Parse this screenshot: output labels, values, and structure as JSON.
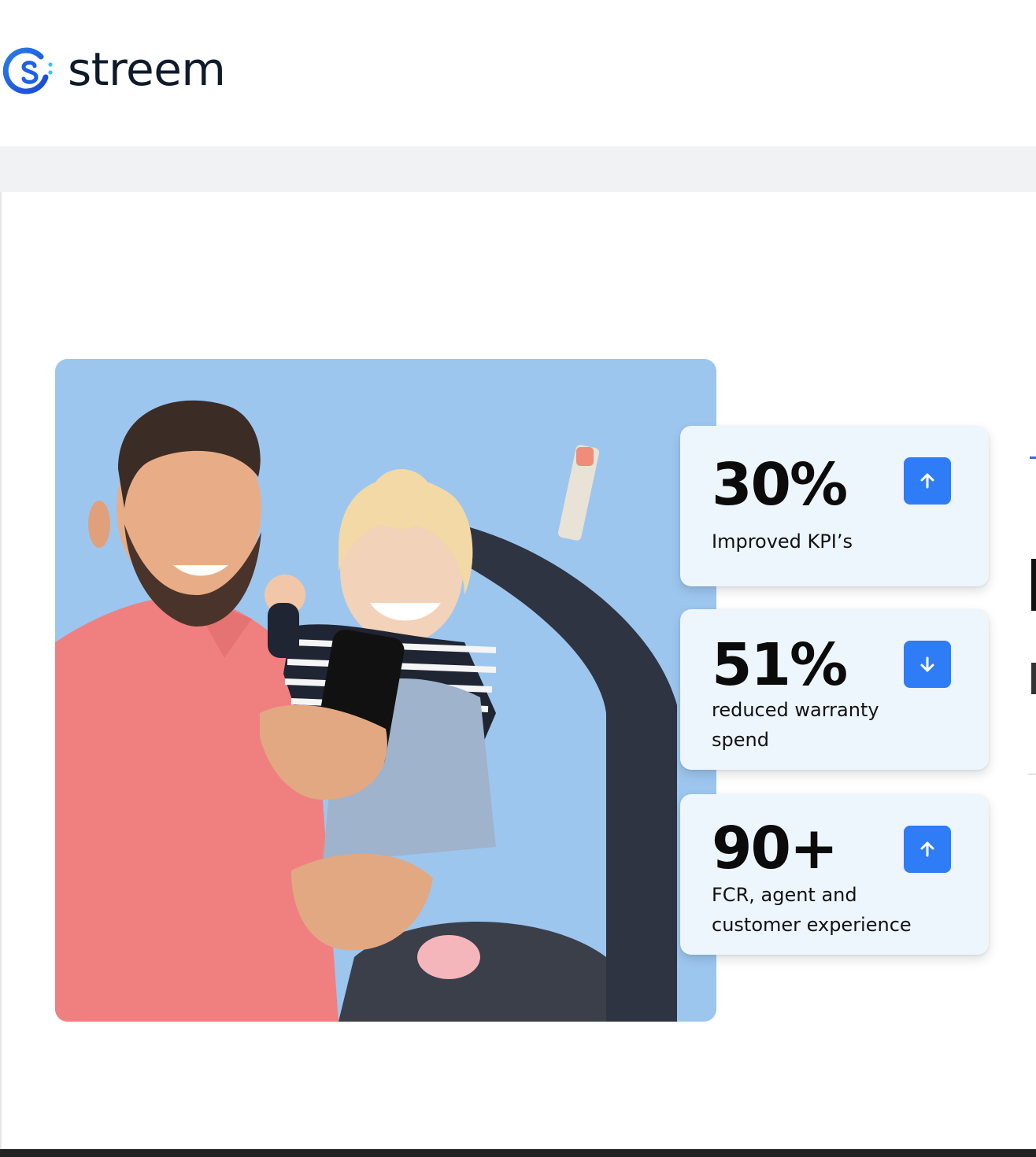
{
  "header": {
    "brand": "streem",
    "logo_icon": "streem-logo-icon"
  },
  "hero": {
    "image_icon": "father-and-child-photo"
  },
  "stats": [
    {
      "value": "30%",
      "label": "Improved KPI’s",
      "trend": "up",
      "icon": "arrow-up-icon"
    },
    {
      "value": "51%",
      "label": "reduced warranty spend",
      "trend": "down",
      "icon": "arrow-down-icon"
    },
    {
      "value": "90+",
      "label": "FCR, agent and customer experience",
      "trend": "up",
      "icon": "arrow-up-icon"
    }
  ],
  "colors": {
    "accent": "#2e7cf6",
    "card_bg": "#edf5fd",
    "photo_bg": "#9dc6ef",
    "brand_blue": "#1d62e6"
  }
}
